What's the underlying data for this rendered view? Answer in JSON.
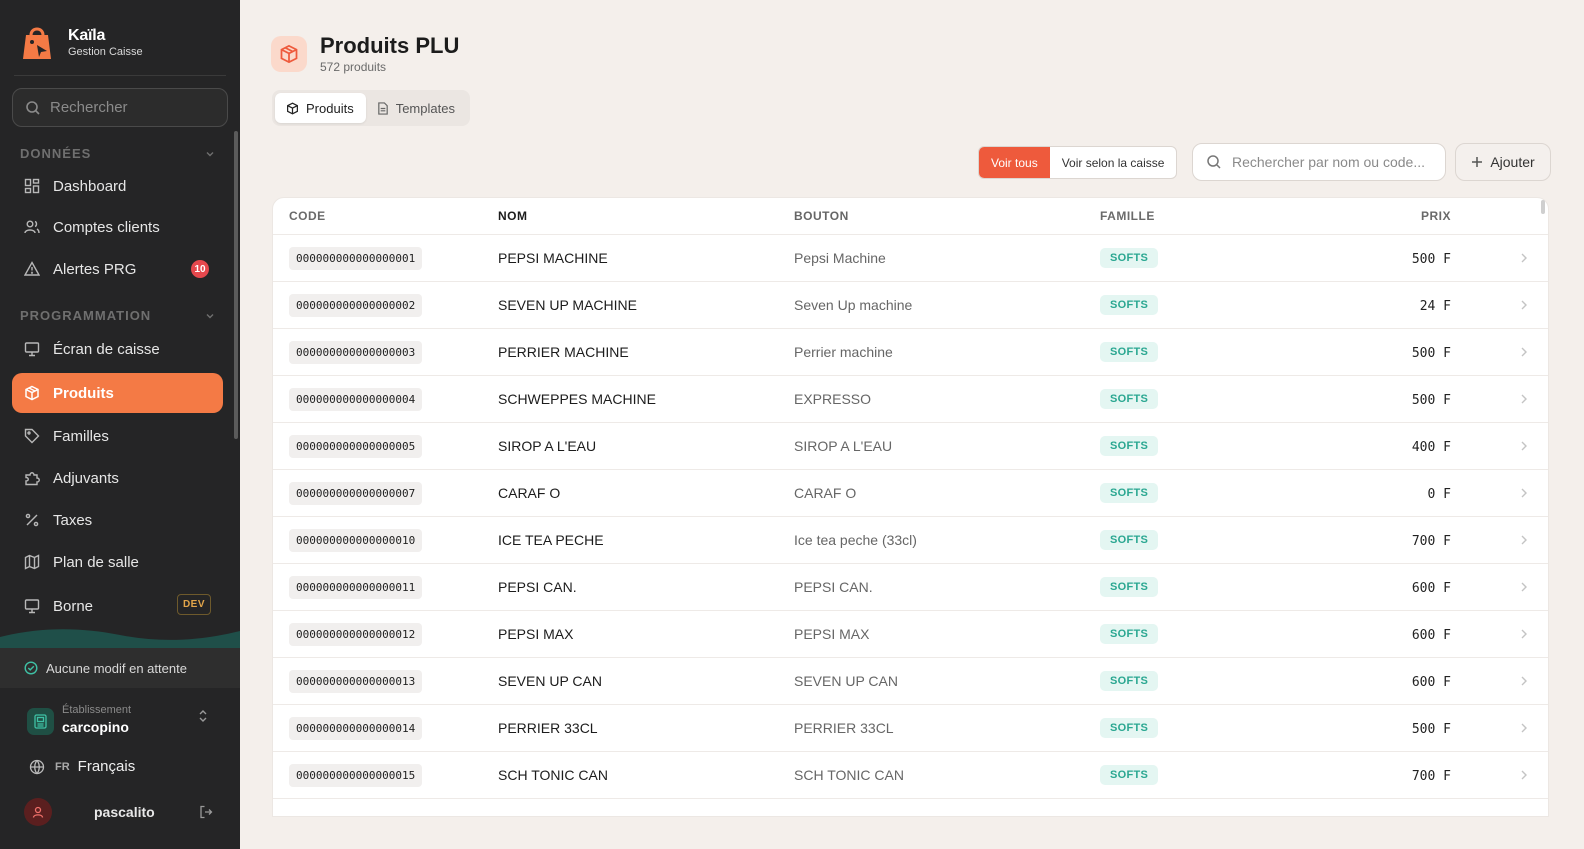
{
  "brand": {
    "name": "Kaïla",
    "subtitle": "Gestion Caisse",
    "accent": "#f47a45"
  },
  "sidebar": {
    "search_placeholder": "Rechercher",
    "section_data": "DONNÉES",
    "section_prog": "PROGRAMMATION",
    "items": [
      {
        "label": "Dashboard",
        "icon": "dashboard-icon"
      },
      {
        "label": "Comptes clients",
        "icon": "users-icon"
      },
      {
        "label": "Alertes PRG",
        "icon": "alert-icon",
        "badge": "10"
      },
      {
        "label": "Écran de caisse",
        "icon": "monitor-icon"
      },
      {
        "label": "Produits",
        "icon": "package-icon",
        "active": true
      },
      {
        "label": "Familles",
        "icon": "tag-icon"
      },
      {
        "label": "Adjuvants",
        "icon": "puzzle-icon"
      },
      {
        "label": "Taxes",
        "icon": "percent-icon"
      },
      {
        "label": "Plan de salle",
        "icon": "map-icon"
      },
      {
        "label": "Borne",
        "icon": "kiosk-icon",
        "badge": "DEV"
      }
    ],
    "pending": "Aucune modif en attente",
    "establishment_label": "Établissement",
    "establishment_value": "carcopino",
    "lang_code": "FR",
    "lang_label": "Français",
    "user": "pascalito"
  },
  "header": {
    "title": "Produits PLU",
    "subtitle": "572 produits"
  },
  "tabs": [
    {
      "label": "Produits"
    },
    {
      "label": "Templates"
    }
  ],
  "toolbar": {
    "all_label": "Voir tous",
    "by_register_label": "Voir selon la caisse",
    "search_placeholder": "Rechercher par nom ou code...",
    "add_label": "Ajouter"
  },
  "table": {
    "columns": [
      "CODE",
      "NOM",
      "BOUTON",
      "FAMILLE",
      "PRIX"
    ],
    "rows": [
      {
        "code": "000000000000000001",
        "nom": "PEPSI MACHINE",
        "bouton": "Pepsi Machine",
        "famille": "SOFTS",
        "prix": "500",
        "devise": "F"
      },
      {
        "code": "000000000000000002",
        "nom": "SEVEN UP MACHINE",
        "bouton": "Seven Up machine",
        "famille": "SOFTS",
        "prix": "24",
        "devise": "F"
      },
      {
        "code": "000000000000000003",
        "nom": "PERRIER MACHINE",
        "bouton": "Perrier machine",
        "famille": "SOFTS",
        "prix": "500",
        "devise": "F"
      },
      {
        "code": "000000000000000004",
        "nom": "SCHWEPPES MACHINE",
        "bouton": "EXPRESSO",
        "famille": "SOFTS",
        "prix": "500",
        "devise": "F"
      },
      {
        "code": "000000000000000005",
        "nom": "SIROP A L'EAU",
        "bouton": "SIROP A L'EAU",
        "famille": "SOFTS",
        "prix": "400",
        "devise": "F"
      },
      {
        "code": "000000000000000007",
        "nom": "CARAF O",
        "bouton": "CARAF O",
        "famille": "SOFTS",
        "prix": "0",
        "devise": "F"
      },
      {
        "code": "000000000000000010",
        "nom": "ICE TEA PECHE",
        "bouton": "Ice tea peche (33cl)",
        "famille": "SOFTS",
        "prix": "700",
        "devise": "F"
      },
      {
        "code": "000000000000000011",
        "nom": "PEPSI CAN.",
        "bouton": "PEPSI CAN.",
        "famille": "SOFTS",
        "prix": "600",
        "devise": "F"
      },
      {
        "code": "000000000000000012",
        "nom": "PEPSI MAX",
        "bouton": "PEPSI MAX",
        "famille": "SOFTS",
        "prix": "600",
        "devise": "F"
      },
      {
        "code": "000000000000000013",
        "nom": "SEVEN UP CAN",
        "bouton": "SEVEN UP CAN",
        "famille": "SOFTS",
        "prix": "600",
        "devise": "F"
      },
      {
        "code": "000000000000000014",
        "nom": "PERRIER 33CL",
        "bouton": "PERRIER 33CL",
        "famille": "SOFTS",
        "prix": "500",
        "devise": "F"
      },
      {
        "code": "000000000000000015",
        "nom": "SCH TONIC CAN",
        "bouton": "SCH TONIC CAN",
        "famille": "SOFTS",
        "prix": "700",
        "devise": "F"
      }
    ]
  }
}
